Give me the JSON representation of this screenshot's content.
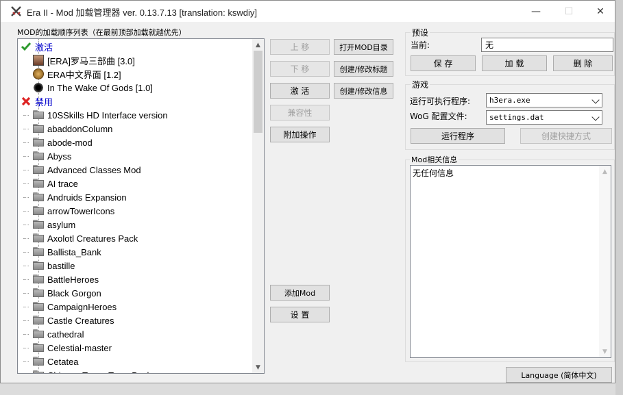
{
  "window": {
    "title": "Era II - Mod 加载管理器 ver. 0.13.7.13 [translation: kswdiy]",
    "controls": {
      "minimize": "—",
      "maximize": "☐",
      "close": "✕"
    }
  },
  "mod_list": {
    "header": "MOD的加载顺序列表（在最前顶部加载就越优先）",
    "active_group": "激活",
    "active_items": [
      "[ERA]罗马三部曲 [3.0]",
      "ERA中文界面 [1.2]",
      "In The Wake Of Gods [1.0]"
    ],
    "disabled_group": "禁用",
    "disabled_items": [
      "10SSkills HD Interface version",
      "abaddonColumn",
      "abode-mod",
      "Abyss",
      "Advanced Classes Mod",
      "AI trace",
      "Andruids Expansion",
      "arrowTowerIcons",
      "asylum",
      "Axolotl Creatures Pack",
      "Ballista_Bank",
      "bastille",
      "BattleHeroes",
      "Black Gorgon",
      "CampaignHeroes",
      "Castle Creatures",
      "cathedral",
      "Celestial-master",
      "Cetatea",
      "Chinese Tower Town Pack"
    ]
  },
  "buttons": {
    "move_up": "上 移",
    "move_down": "下 移",
    "activate": "激 活",
    "compat": "兼容性",
    "extra_ops": "附加操作",
    "open_mod_dir": "打开MOD目录",
    "edit_title": "创建/修改标题",
    "edit_info": "创建/修改信息",
    "add_mod": "添加Mod",
    "settings": "设 置"
  },
  "presets": {
    "group_label": "预设",
    "current_label": "当前:",
    "current_value": "无",
    "save": "保 存",
    "load": "加 载",
    "delete": "删 除"
  },
  "game": {
    "group_label": "游戏",
    "exe_label": "运行可执行程序:",
    "exe_value": "h3era.exe",
    "wog_label": "WoG 配置文件:",
    "wog_value": "settings.dat",
    "run": "运行程序",
    "shortcut": "创建快捷方式"
  },
  "mod_info": {
    "label": "Mod相关信息",
    "text": "无任何信息"
  },
  "language_button": "Language (简体中文)"
}
